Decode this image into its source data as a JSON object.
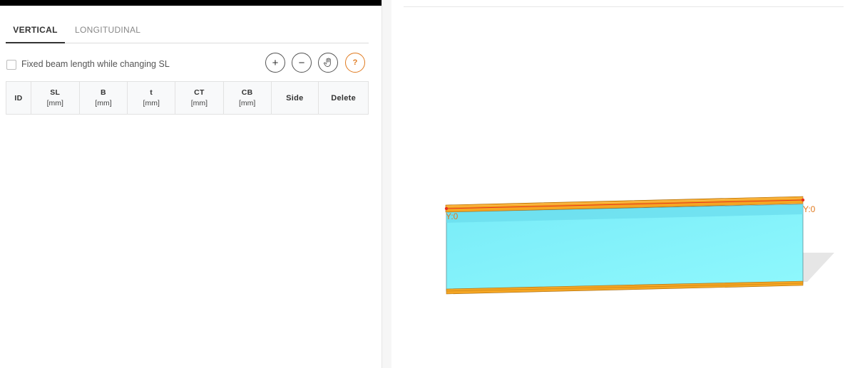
{
  "tabs": {
    "vertical": "VERTICAL",
    "longitudinal": "LONGITUDINAL"
  },
  "options": {
    "fixed_beam_label": "Fixed beam length while changing SL",
    "fixed_beam_checked": false
  },
  "toolbar": {
    "zoom_in_icon": "plus-icon",
    "zoom_out_icon": "minus-icon",
    "pan_icon": "hand-icon",
    "help_label": "?"
  },
  "table": {
    "columns": [
      {
        "name": "ID",
        "unit": ""
      },
      {
        "name": "SL",
        "unit": "[mm]"
      },
      {
        "name": "B",
        "unit": "[mm]"
      },
      {
        "name": "t",
        "unit": "[mm]"
      },
      {
        "name": "CT",
        "unit": "[mm]"
      },
      {
        "name": "CB",
        "unit": "[mm]"
      },
      {
        "name": "Side",
        "unit": ""
      },
      {
        "name": "Delete",
        "unit": ""
      }
    ],
    "rows": []
  },
  "viewport": {
    "label_left": "Y:0",
    "label_right": "Y:0"
  },
  "colors": {
    "flange": "#f5a623",
    "web": "#7cf0fb",
    "accent": "#e07a1f"
  }
}
